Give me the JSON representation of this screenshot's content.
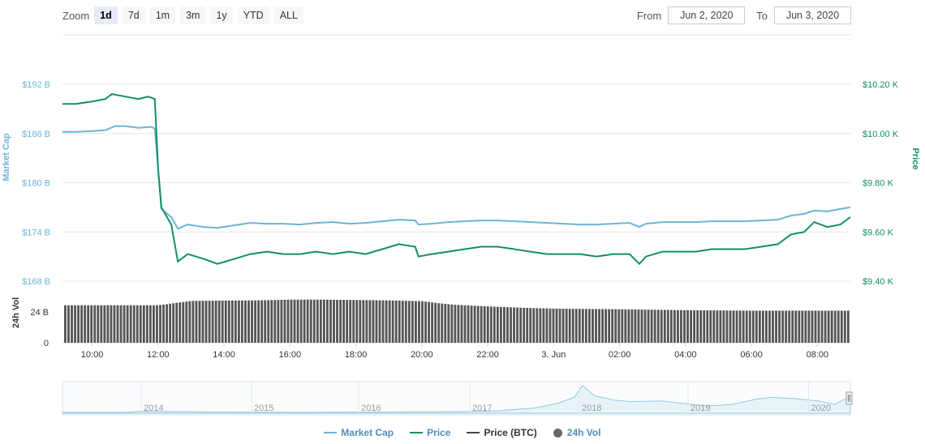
{
  "zoom": {
    "label": "Zoom",
    "buttons": [
      "1d",
      "7d",
      "1m",
      "3m",
      "1y",
      "YTD",
      "ALL"
    ],
    "active": "1d"
  },
  "range": {
    "from_label": "From",
    "from_value": "Jun 2, 2020",
    "to_label": "To",
    "to_value": "Jun 3, 2020"
  },
  "colors": {
    "market_cap": "#6cb4d6",
    "price": "#138d6c",
    "price_btc": "#444444",
    "volume": "#555555",
    "grid": "#e6e6e6"
  },
  "chart_data": {
    "type": "line",
    "axes": {
      "left_title": "Market Cap",
      "left_ticks": [
        "$192 B",
        "$186 B",
        "$180 B",
        "$174 B",
        "$168 B"
      ],
      "left_range_billions": [
        168,
        192
      ],
      "right_title": "Price",
      "right_ticks": [
        "$10.20 K",
        "$10.00 K",
        "$9.80 K",
        "$9.60 K",
        "$9.40 K"
      ],
      "right_range_k": [
        9.4,
        10.2
      ],
      "vol_title": "24h Vol",
      "vol_ticks": [
        "24 B",
        "0"
      ],
      "vol_range_billions": [
        0,
        48
      ],
      "x_ticks": [
        "10:00",
        "12:00",
        "14:00",
        "16:00",
        "18:00",
        "20:00",
        "22:00",
        "3. Jun",
        "02:00",
        "04:00",
        "06:00",
        "08:00"
      ],
      "x_range_hours": [
        9.1,
        33.0
      ]
    },
    "series": [
      {
        "name": "Market Cap",
        "unit": "B USD",
        "points": [
          [
            9.1,
            186.2
          ],
          [
            9.5,
            186.2
          ],
          [
            10.0,
            186.3
          ],
          [
            10.4,
            186.4
          ],
          [
            10.7,
            186.9
          ],
          [
            11.0,
            186.9
          ],
          [
            11.4,
            186.7
          ],
          [
            11.8,
            186.8
          ],
          [
            11.9,
            186.6
          ],
          [
            12.1,
            176.8
          ],
          [
            12.4,
            175.8
          ],
          [
            12.6,
            174.4
          ],
          [
            12.9,
            174.9
          ],
          [
            13.4,
            174.6
          ],
          [
            13.8,
            174.5
          ],
          [
            14.3,
            174.8
          ],
          [
            14.8,
            175.1
          ],
          [
            15.3,
            175.0
          ],
          [
            15.8,
            175.0
          ],
          [
            16.3,
            174.9
          ],
          [
            16.8,
            175.1
          ],
          [
            17.3,
            175.2
          ],
          [
            17.8,
            175.0
          ],
          [
            18.3,
            175.1
          ],
          [
            18.8,
            175.3
          ],
          [
            19.3,
            175.5
          ],
          [
            19.8,
            175.4
          ],
          [
            19.9,
            174.9
          ],
          [
            20.3,
            175.0
          ],
          [
            20.8,
            175.2
          ],
          [
            21.3,
            175.3
          ],
          [
            21.8,
            175.4
          ],
          [
            22.3,
            175.4
          ],
          [
            22.8,
            175.3
          ],
          [
            23.3,
            175.2
          ],
          [
            23.8,
            175.1
          ],
          [
            24.3,
            175.0
          ],
          [
            24.8,
            174.9
          ],
          [
            25.3,
            174.9
          ],
          [
            25.8,
            175.0
          ],
          [
            26.3,
            175.1
          ],
          [
            26.6,
            174.6
          ],
          [
            26.8,
            175.0
          ],
          [
            27.3,
            175.2
          ],
          [
            27.8,
            175.2
          ],
          [
            28.3,
            175.2
          ],
          [
            28.8,
            175.3
          ],
          [
            29.3,
            175.3
          ],
          [
            29.8,
            175.3
          ],
          [
            30.3,
            175.4
          ],
          [
            30.8,
            175.5
          ],
          [
            31.2,
            176.0
          ],
          [
            31.6,
            176.2
          ],
          [
            31.9,
            176.6
          ],
          [
            32.3,
            176.5
          ],
          [
            32.7,
            176.8
          ],
          [
            33.0,
            177.0
          ]
        ]
      },
      {
        "name": "Price",
        "unit": "K USD",
        "points": [
          [
            9.1,
            10.12
          ],
          [
            9.5,
            10.12
          ],
          [
            10.0,
            10.13
          ],
          [
            10.4,
            10.14
          ],
          [
            10.6,
            10.16
          ],
          [
            11.0,
            10.15
          ],
          [
            11.4,
            10.14
          ],
          [
            11.7,
            10.15
          ],
          [
            11.9,
            10.14
          ],
          [
            12.0,
            9.86
          ],
          [
            12.1,
            9.7
          ],
          [
            12.4,
            9.63
          ],
          [
            12.6,
            9.48
          ],
          [
            12.9,
            9.51
          ],
          [
            13.4,
            9.49
          ],
          [
            13.8,
            9.47
          ],
          [
            14.3,
            9.49
          ],
          [
            14.8,
            9.51
          ],
          [
            15.3,
            9.52
          ],
          [
            15.8,
            9.51
          ],
          [
            16.3,
            9.51
          ],
          [
            16.8,
            9.52
          ],
          [
            17.3,
            9.51
          ],
          [
            17.8,
            9.52
          ],
          [
            18.3,
            9.51
          ],
          [
            18.8,
            9.53
          ],
          [
            19.3,
            9.55
          ],
          [
            19.8,
            9.54
          ],
          [
            19.9,
            9.5
          ],
          [
            20.3,
            9.51
          ],
          [
            20.8,
            9.52
          ],
          [
            21.3,
            9.53
          ],
          [
            21.8,
            9.54
          ],
          [
            22.3,
            9.54
          ],
          [
            22.8,
            9.53
          ],
          [
            23.3,
            9.52
          ],
          [
            23.8,
            9.51
          ],
          [
            24.3,
            9.51
          ],
          [
            24.8,
            9.51
          ],
          [
            25.3,
            9.5
          ],
          [
            25.8,
            9.51
          ],
          [
            26.3,
            9.51
          ],
          [
            26.6,
            9.47
          ],
          [
            26.8,
            9.5
          ],
          [
            27.3,
            9.52
          ],
          [
            27.8,
            9.52
          ],
          [
            28.3,
            9.52
          ],
          [
            28.8,
            9.53
          ],
          [
            29.3,
            9.53
          ],
          [
            29.8,
            9.53
          ],
          [
            30.3,
            9.54
          ],
          [
            30.8,
            9.55
          ],
          [
            31.2,
            9.59
          ],
          [
            31.6,
            9.6
          ],
          [
            31.9,
            9.64
          ],
          [
            32.3,
            9.62
          ],
          [
            32.7,
            9.63
          ],
          [
            33.0,
            9.66
          ]
        ]
      },
      {
        "name": "Price (BTC)",
        "points": []
      },
      {
        "name": "24h Vol",
        "unit": "B USD",
        "points": [
          [
            9.1,
            29.2
          ],
          [
            12.0,
            29.2
          ],
          [
            12.5,
            31.0
          ],
          [
            13.0,
            32.6
          ],
          [
            14.0,
            32.9
          ],
          [
            15.0,
            33.0
          ],
          [
            16.0,
            33.6
          ],
          [
            17.0,
            33.6
          ],
          [
            18.0,
            33.3
          ],
          [
            19.0,
            33.0
          ],
          [
            20.0,
            32.4
          ],
          [
            20.5,
            30.8
          ],
          [
            21.0,
            29.6
          ],
          [
            22.0,
            28.3
          ],
          [
            23.0,
            27.3
          ],
          [
            24.0,
            26.6
          ],
          [
            26.0,
            26.1
          ],
          [
            28.0,
            25.4
          ],
          [
            30.0,
            25.0
          ],
          [
            33.0,
            25.0
          ]
        ]
      }
    ],
    "navigator": {
      "x_ticks": [
        "2014",
        "2015",
        "2016",
        "2017",
        "2018",
        "2019",
        "2020"
      ]
    },
    "legend": {
      "placement": "bottom-center",
      "items": [
        "Market Cap",
        "Price",
        "Price (BTC)",
        "24h Vol"
      ]
    },
    "grid": true
  }
}
